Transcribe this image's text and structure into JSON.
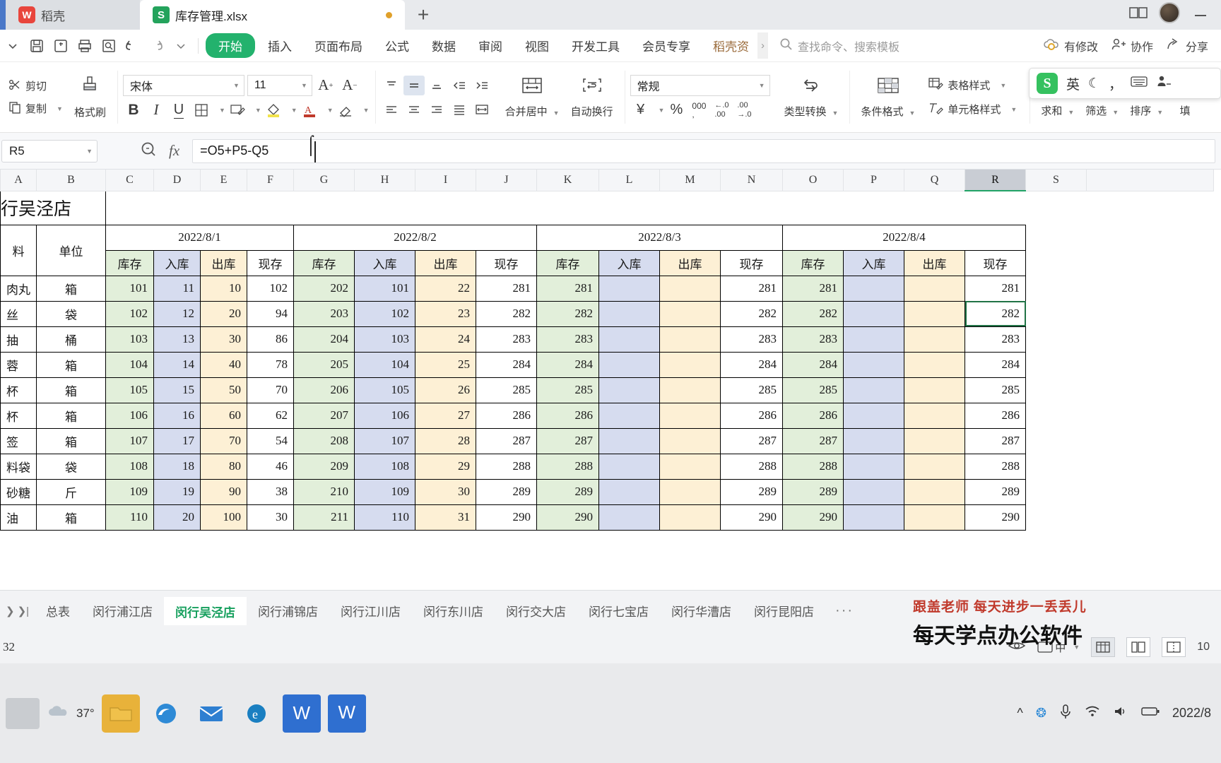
{
  "window": {
    "docker_tab": "稻壳",
    "file_tab": "库存管理.xlsx",
    "new_tab_icon": "plus-icon",
    "restore_icon": "restore-window-icon",
    "minimize_icon": "minimize-icon",
    "avatar_icon": "user-avatar"
  },
  "ribbon": {
    "quick_access": [
      {
        "name": "save-icon",
        "glyph": "save"
      },
      {
        "name": "save-as-icon",
        "glyph": "saveas"
      },
      {
        "name": "print-icon",
        "glyph": "print"
      },
      {
        "name": "print-preview-icon",
        "glyph": "preview"
      },
      {
        "name": "undo-icon",
        "glyph": "undo"
      },
      {
        "name": "redo-icon",
        "glyph": "redo"
      },
      {
        "name": "customize-qat-icon",
        "glyph": "chevron"
      }
    ],
    "tabs": [
      {
        "label": "开始",
        "active": true
      },
      {
        "label": "插入",
        "active": false
      },
      {
        "label": "页面布局",
        "active": false
      },
      {
        "label": "公式",
        "active": false
      },
      {
        "label": "数据",
        "active": false
      },
      {
        "label": "审阅",
        "active": false
      },
      {
        "label": "视图",
        "active": false
      },
      {
        "label": "开发工具",
        "active": false
      },
      {
        "label": "会员专享",
        "active": false
      },
      {
        "label": "稻壳资",
        "active": false
      }
    ],
    "search_placeholder": "查找命令、搜索模板",
    "cloud_status": "有修改",
    "collaborate": "协作",
    "share": "分享"
  },
  "toolbar": {
    "cut": "剪切",
    "copy": "复制",
    "format_painter": "格式刷",
    "font_name": "宋体",
    "font_size": "11",
    "grow_font": "A+",
    "shrink_font": "A-",
    "bold": "B",
    "italic": "I",
    "underline": "U",
    "merge_center": "合并居中",
    "wrap_text": "自动换行",
    "number_format": "常规",
    "type_convert": "类型转换",
    "conditional_format": "条件格式",
    "table_style": "表格样式",
    "cell_style": "单元格样式",
    "autosum": "求和",
    "filter": "筛选",
    "sort": "排序",
    "fill": "填"
  },
  "formula_bar": {
    "name_box": "R5",
    "formula": "=O5+P5-Q5",
    "insert_function_icon": "fx-icon",
    "zoom_icon": "magnifier-icon"
  },
  "grid": {
    "columns": [
      "A",
      "B",
      "C",
      "D",
      "E",
      "F",
      "G",
      "H",
      "I",
      "J",
      "K",
      "L",
      "M",
      "N",
      "O",
      "P",
      "Q",
      "R",
      "S"
    ],
    "selected_column": "R",
    "selected_cell": "R5",
    "title": "行吴泾店",
    "date_groups": [
      "2022/8/1",
      "2022/8/2",
      "2022/8/3",
      "2022/8/4"
    ],
    "sub_headers": [
      "库存",
      "入库",
      "出库",
      "现存"
    ],
    "label_headers": [
      "料",
      "单位"
    ],
    "rows": [
      {
        "name": "肉丸",
        "unit": "箱",
        "values": [
          101,
          11,
          10,
          102,
          202,
          101,
          22,
          281,
          281,
          "",
          "",
          281,
          281,
          "",
          "",
          281
        ]
      },
      {
        "name": "丝",
        "unit": "袋",
        "values": [
          102,
          12,
          20,
          94,
          203,
          102,
          23,
          282,
          282,
          "",
          "",
          282,
          282,
          "",
          "",
          282
        ]
      },
      {
        "name": "抽",
        "unit": "桶",
        "values": [
          103,
          13,
          30,
          86,
          204,
          103,
          24,
          283,
          283,
          "",
          "",
          283,
          283,
          "",
          "",
          283
        ]
      },
      {
        "name": "蓉",
        "unit": "箱",
        "values": [
          104,
          14,
          40,
          78,
          205,
          104,
          25,
          284,
          284,
          "",
          "",
          284,
          284,
          "",
          "",
          284
        ]
      },
      {
        "name": "杯",
        "unit": "箱",
        "values": [
          105,
          15,
          50,
          70,
          206,
          105,
          26,
          285,
          285,
          "",
          "",
          285,
          285,
          "",
          "",
          285
        ]
      },
      {
        "name": "杯",
        "unit": "箱",
        "values": [
          106,
          16,
          60,
          62,
          207,
          106,
          27,
          286,
          286,
          "",
          "",
          286,
          286,
          "",
          "",
          286
        ]
      },
      {
        "name": "签",
        "unit": "箱",
        "values": [
          107,
          17,
          70,
          54,
          208,
          107,
          28,
          287,
          287,
          "",
          "",
          287,
          287,
          "",
          "",
          287
        ]
      },
      {
        "name": "料袋",
        "unit": "袋",
        "values": [
          108,
          18,
          80,
          46,
          209,
          108,
          29,
          288,
          288,
          "",
          "",
          288,
          288,
          "",
          "",
          288
        ]
      },
      {
        "name": "砂糖",
        "unit": "斤",
        "values": [
          109,
          19,
          90,
          38,
          210,
          109,
          30,
          289,
          289,
          "",
          "",
          289,
          289,
          "",
          "",
          289
        ]
      },
      {
        "name": "油",
        "unit": "箱",
        "values": [
          110,
          20,
          100,
          30,
          211,
          110,
          31,
          290,
          290,
          "",
          "",
          290,
          290,
          "",
          "",
          290
        ]
      }
    ]
  },
  "sheet_tabs": {
    "items": [
      {
        "label": "总表",
        "active": false
      },
      {
        "label": "闵行浦江店",
        "active": false
      },
      {
        "label": "闵行吴泾店",
        "active": true
      },
      {
        "label": "闵行浦锦店",
        "active": false
      },
      {
        "label": "闵行江川店",
        "active": false
      },
      {
        "label": "闵行东川店",
        "active": false
      },
      {
        "label": "闵行交大店",
        "active": false
      },
      {
        "label": "闵行七宝店",
        "active": false
      },
      {
        "label": "闵行华漕店",
        "active": false
      },
      {
        "label": "闵行昆阳店",
        "active": false
      }
    ],
    "more": "···"
  },
  "status_bar": {
    "left_text": "32",
    "zoom_value": "10",
    "eye_icon": "eye-icon",
    "ime_icon": "ime-chinese-icon",
    "view_normal": "normal-view-icon",
    "view_page": "page-layout-icon",
    "view_break": "page-break-icon"
  },
  "ime_toolbar": {
    "logo": "S",
    "mode": "英",
    "moon_icon": "moon-icon",
    "punct_icon": "punctuation-icon",
    "keyboard_icon": "keyboard-icon",
    "user_icon": "user-icon"
  },
  "watermark": {
    "line1": "跟盖老师  每天进步一丢丢儿",
    "line2": "每天学点办公软件"
  },
  "taskbar": {
    "temperature": "37°",
    "date": "2022/8",
    "apps": [
      {
        "name": "file-explorer-icon",
        "color": "#e8b23a"
      },
      {
        "name": "edge-icon",
        "color": "#2e7fd1"
      },
      {
        "name": "mail-icon",
        "color": "#2e7fd1"
      },
      {
        "name": "ie-icon",
        "color": "#1a7fc1"
      },
      {
        "name": "wps-writer-icon",
        "color": "#2f6fd0"
      },
      {
        "name": "wps-spreadsheet-icon",
        "color": "#21a366"
      }
    ]
  },
  "colors": {
    "accent_green": "#21a366",
    "stock": "#e2efda",
    "inbound": "#d6dcef",
    "outbound": "#fdf0d5",
    "present": "#ffffff"
  }
}
